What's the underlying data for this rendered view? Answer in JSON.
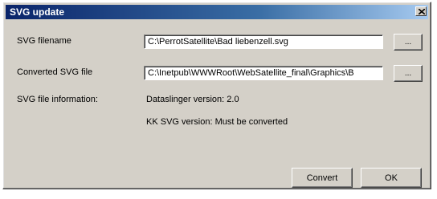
{
  "window": {
    "title": "SVG update",
    "close_glyph": "×"
  },
  "form": {
    "svg_filename_label": "SVG filename",
    "svg_filename_value": "C:\\PerrotSatellite\\Bad liebenzell.svg",
    "converted_label": "Converted SVG file",
    "converted_value": "C:\\Inetpub\\WWWRoot\\WebSatellite_final\\Graphics\\B",
    "info_label": "SVG file information:",
    "dataslinger_version": "Dataslinger version: 2.0",
    "kk_svg_version": "KK SVG version: Must be converted"
  },
  "buttons": {
    "browse_label": "...",
    "convert_label": "Convert",
    "ok_label": "OK"
  },
  "colors": {
    "titlebar_start": "#0a246a",
    "titlebar_end": "#a6caf0",
    "dialog_face": "#d4d0c8"
  }
}
